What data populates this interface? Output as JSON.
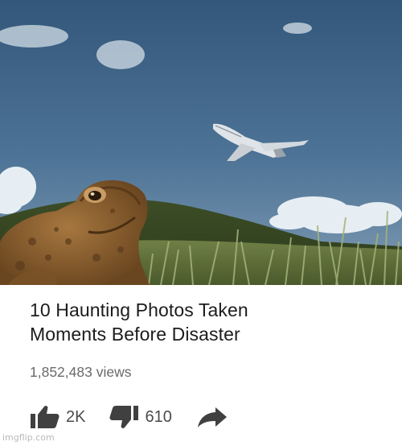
{
  "video": {
    "title_line1": "10 Haunting Photos Taken",
    "title_line2": "Moments Before Disaster",
    "views": "1,852,483 views"
  },
  "actions": {
    "likes": "2K",
    "dislikes": "610",
    "like_icon": "thumbs-up-icon",
    "dislike_icon": "thumbs-down-icon",
    "share_icon": "share-arrow-icon"
  },
  "watermark": "imgflip.com",
  "colors": {
    "title": "#1c1c1c",
    "meta": "#6a6a6a",
    "icon": "#404040"
  }
}
